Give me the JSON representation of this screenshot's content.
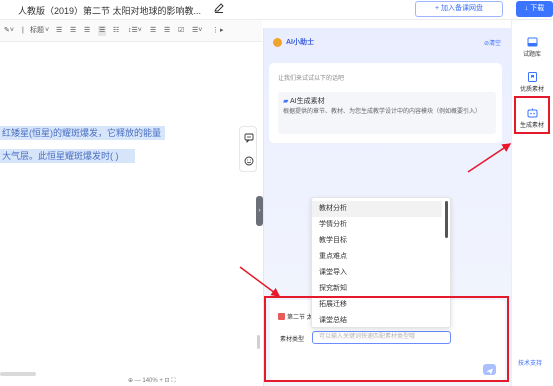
{
  "header": {
    "doc_title": "人教版（2019）第二节 太阳对地球的影响教...",
    "add_button": "+ 加入备课网盘",
    "download_button": "↓ 下载"
  },
  "toolbar": {
    "heading_label": "标题"
  },
  "editor": {
    "line1": "红矮星(恒星)的耀斑爆发，它释放的能量",
    "line2": "大气层。此恒星耀斑爆发时(   )",
    "status_text": "⊕  —  140%  +  ⊡  ⛶"
  },
  "assistant": {
    "title": "AI小助士",
    "clear_label": "⊘清空",
    "tip": "让我们来试试以下的话吧",
    "card_title": "AI生成素材",
    "card_desc": "根据提供的章节、教材、为您生成教学设计中的内容模块（例如概要引入）",
    "section_chip": "第二节 太",
    "type_label": "素材类型",
    "type_placeholder": "可以输入关键词快速匹配素材类型哦"
  },
  "dropdown": {
    "options": [
      "教材分析",
      "学情分析",
      "教学目标",
      "重点难点",
      "课堂导入",
      "探究新知",
      "拓展迁移",
      "课堂总结"
    ]
  },
  "rail": {
    "items": [
      "试题库",
      "优质素材",
      "生成素材"
    ],
    "footer": "技术支持"
  },
  "colors": {
    "accent": "#3a74ff",
    "annotation": "#e5192b",
    "highlight": "#d7e5fb"
  }
}
